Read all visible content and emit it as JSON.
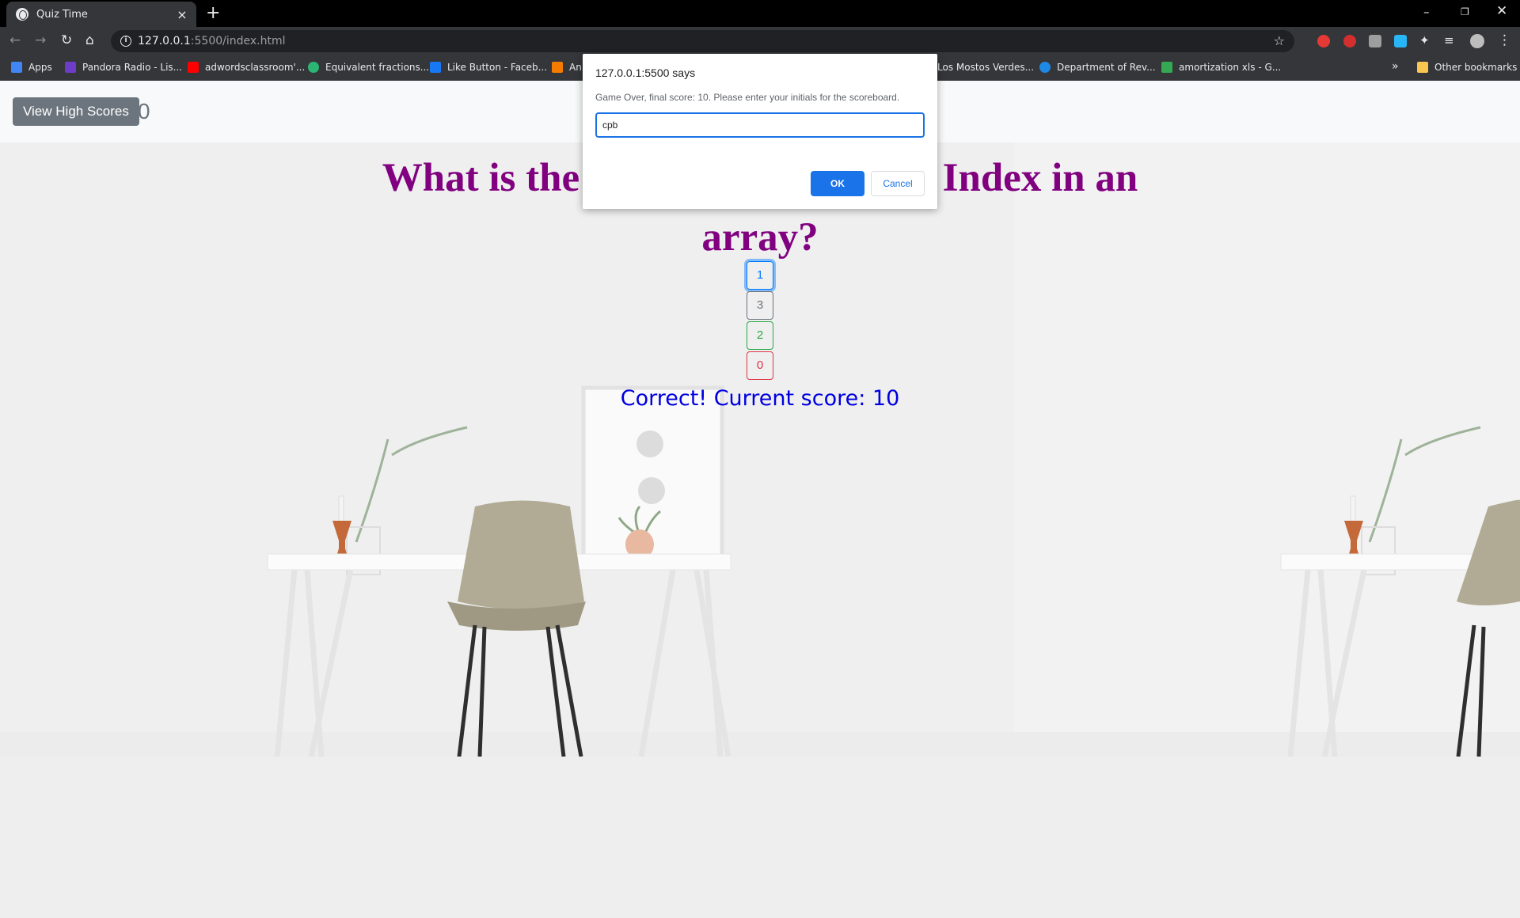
{
  "browser": {
    "tab_title": "Quiz Time",
    "tab_close": "×",
    "new_tab": "+",
    "url_host": "127.0.0.1",
    "url_path": ":5500/index.html",
    "bookmarks": [
      {
        "label": "Apps",
        "icon": "apps-grid-icon",
        "color": "#4285f4"
      },
      {
        "label": "Pandora Radio - Lis...",
        "icon": "pandora-icon",
        "color": "#6c3dc7"
      },
      {
        "label": "adwordsclassroom'...",
        "icon": "youtube-icon",
        "color": "#ff0000"
      },
      {
        "label": "Equivalent fractions...",
        "icon": "shield-check-icon",
        "color": "#2bb673"
      },
      {
        "label": "Like Button - Faceb...",
        "icon": "facebook-icon",
        "color": "#1877f2"
      },
      {
        "label": "An",
        "icon": "chart-icon",
        "color": "#f57c00"
      },
      {
        "label": "Los Mostos Verdes...",
        "icon": "",
        "color": ""
      },
      {
        "label": "Department of Rev...",
        "icon": "globe-icon",
        "color": "#1e88e5"
      },
      {
        "label": "amortization xls - G...",
        "icon": "google-icon",
        "color": "#34a853"
      }
    ],
    "more_bookmarks": "»",
    "other_bookmarks": "Other bookmarks"
  },
  "header": {
    "high_scores_label": "View High Scores",
    "timer": "0"
  },
  "quiz": {
    "question": "What is the number for the first Index in an array?",
    "answers": [
      {
        "label": "1",
        "style": "primary"
      },
      {
        "label": "3",
        "style": "secondary"
      },
      {
        "label": "2",
        "style": "success"
      },
      {
        "label": "0",
        "style": "danger"
      }
    ],
    "feedback": "Correct! Current score: 10"
  },
  "dialog": {
    "title": "127.0.0.1:5500 says",
    "message": "Game Over, final score: 10. Please enter your initials for the scoreboard.",
    "input_value": "cpb",
    "ok_label": "OK",
    "cancel_label": "Cancel"
  },
  "colors": {
    "question": "#800080",
    "feedback": "#0000e0",
    "dialog_accent": "#1a73e8"
  }
}
